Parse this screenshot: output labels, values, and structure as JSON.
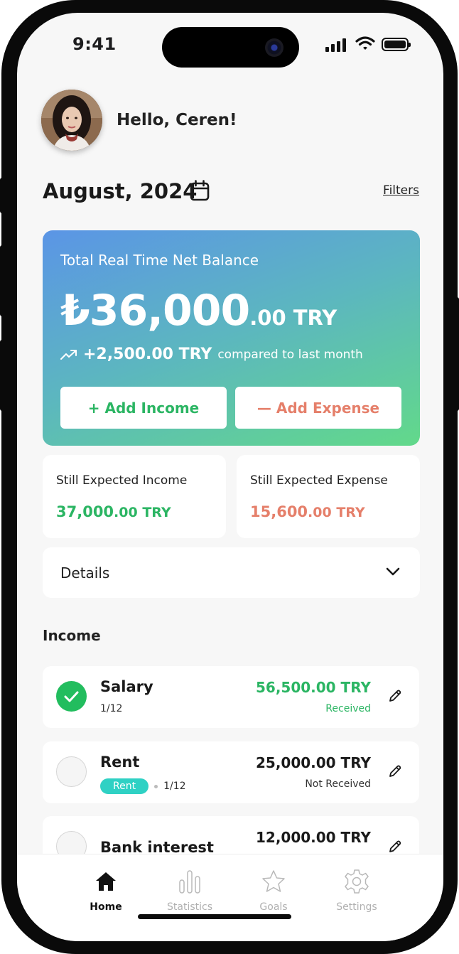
{
  "status_bar": {
    "time": "9:41"
  },
  "header": {
    "greeting": "Hello, Ceren!"
  },
  "period": {
    "month_label": "August, 2024",
    "filters_label": "Filters"
  },
  "balance_card": {
    "title": "Total Real Time Net Balance",
    "amount_main": "₺36,000",
    "amount_decimals": ".00 TRY",
    "change_value": "+2,500.00 TRY",
    "change_text": "compared to last month",
    "add_income_label": "+ Add Income",
    "add_expense_label": "— Add Expense"
  },
  "expected": {
    "income_label": "Still Expected Income",
    "income_value": "37,000",
    "income_decimals": ".00 TRY",
    "expense_label": "Still Expected Expense",
    "expense_value": "15,600",
    "expense_decimals": ".00 TRY"
  },
  "details": {
    "label": "Details"
  },
  "income_section": {
    "title": "Income",
    "items": [
      {
        "name": "Salary",
        "period": "1/12",
        "amount": "56,500.00 TRY",
        "status": "Received",
        "checked": true
      },
      {
        "name": "Rent",
        "tag": "Rent",
        "period": "1/12",
        "amount": "25,000.00 TRY",
        "status": "Not Received",
        "checked": false
      },
      {
        "name": "Bank interest",
        "amount": "12,000.00 TRY",
        "checked": false
      }
    ]
  },
  "colors": {
    "income_green": "#2bb563",
    "expense_red": "#e57f6a",
    "tag_teal": "#2fd1c4",
    "card_gradient_start": "#5b95e6",
    "card_gradient_end": "#62d98a"
  },
  "bottom_nav": {
    "items": [
      {
        "label": "Home",
        "icon": "home-icon",
        "active": true
      },
      {
        "label": "Statistics",
        "icon": "bar-chart-icon",
        "active": false
      },
      {
        "label": "Goals",
        "icon": "star-icon",
        "active": false
      },
      {
        "label": "Settings",
        "icon": "gear-icon",
        "active": false
      }
    ]
  }
}
